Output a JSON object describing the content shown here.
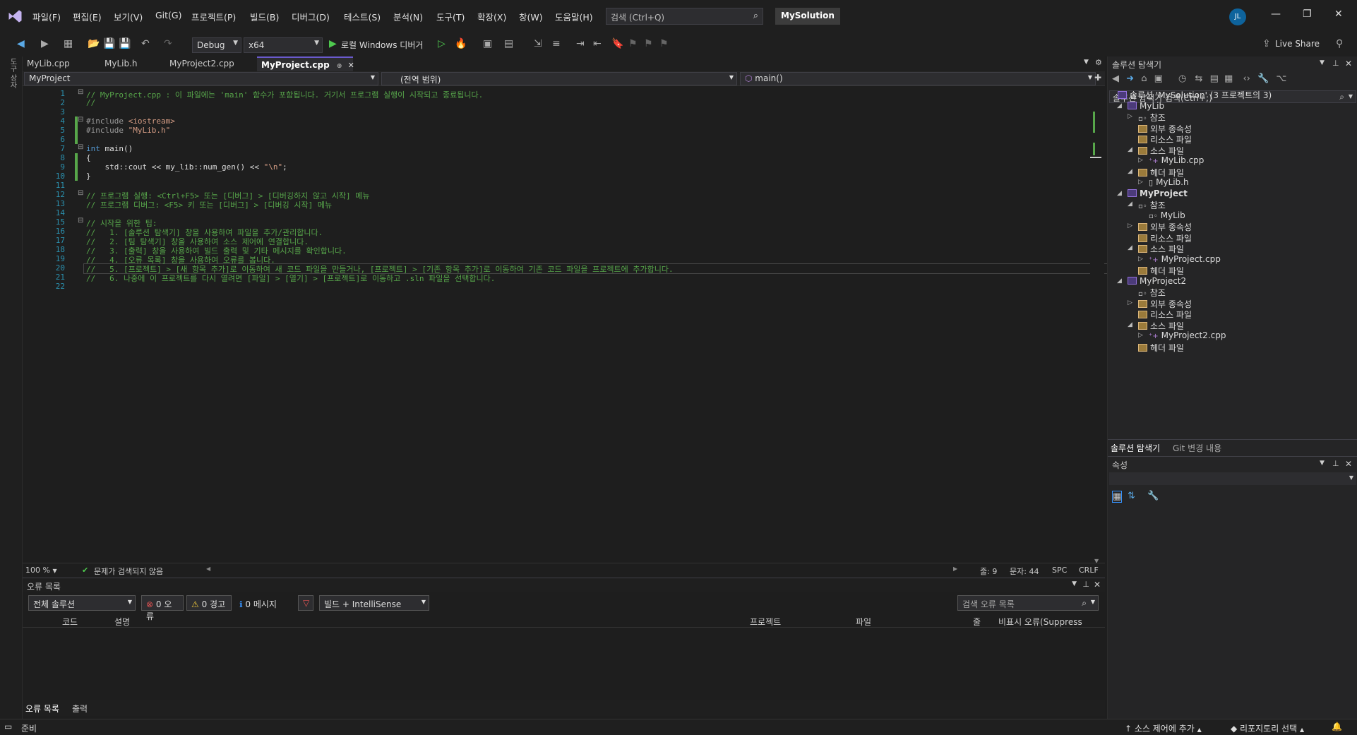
{
  "menubar": {
    "items": [
      "파일(F)",
      "편집(E)",
      "보기(V)",
      "Git(G)",
      "프로젝트(P)",
      "빌드(B)",
      "디버그(D)",
      "테스트(S)",
      "분석(N)",
      "도구(T)",
      "확장(X)",
      "창(W)",
      "도움말(H)"
    ],
    "search_placeholder": "검색 (Ctrl+Q)",
    "solution_name": "MySolution",
    "avatar_initials": "JL"
  },
  "toolbar": {
    "config": "Debug",
    "platform": "x64",
    "run_label": "로컬 Windows 디버거",
    "live_share": "Live Share"
  },
  "tabs": [
    "MyLib.cpp",
    "MyLib.h",
    "MyProject2.cpp",
    "MyProject.cpp"
  ],
  "navbar": {
    "project": "MyProject",
    "scope": "(전역 범위)",
    "member": "main()"
  },
  "code": {
    "lines": [
      {
        "n": "1",
        "segs": [
          {
            "c": "cmt",
            "t": "// MyProject.cpp : 이 파일에는 'main' 함수가 포함됩니다. 거기서 프로그램 실행이 시작되고 종료됩니다."
          }
        ]
      },
      {
        "n": "2",
        "segs": [
          {
            "c": "cmt",
            "t": "//"
          }
        ]
      },
      {
        "n": "3",
        "segs": []
      },
      {
        "n": "4",
        "segs": [
          {
            "c": "pp",
            "t": "#include "
          },
          {
            "c": "str",
            "t": "<iostream>"
          }
        ]
      },
      {
        "n": "5",
        "segs": [
          {
            "c": "pp",
            "t": "#include "
          },
          {
            "c": "str",
            "t": "\"MyLib.h\""
          }
        ]
      },
      {
        "n": "6",
        "segs": []
      },
      {
        "n": "7",
        "segs": [
          {
            "c": "kw",
            "t": "int"
          },
          {
            "c": "txt",
            "t": " main()"
          }
        ]
      },
      {
        "n": "8",
        "segs": [
          {
            "c": "txt",
            "t": "{"
          }
        ]
      },
      {
        "n": "9",
        "segs": [
          {
            "c": "txt",
            "t": "    std::cout << my_lib::num_gen() << "
          },
          {
            "c": "str",
            "t": "\"\\n\""
          },
          {
            "c": "txt",
            "t": ";"
          }
        ]
      },
      {
        "n": "10",
        "segs": [
          {
            "c": "txt",
            "t": "}"
          }
        ]
      },
      {
        "n": "11",
        "segs": []
      },
      {
        "n": "12",
        "segs": [
          {
            "c": "cmt",
            "t": "// 프로그램 실행: <Ctrl+F5> 또는 [디버그] > [디버깅하지 않고 시작] 메뉴"
          }
        ]
      },
      {
        "n": "13",
        "segs": [
          {
            "c": "cmt",
            "t": "// 프로그램 디버그: <F5> 키 또는 [디버그] > [디버깅 시작] 메뉴"
          }
        ]
      },
      {
        "n": "14",
        "segs": []
      },
      {
        "n": "15",
        "segs": [
          {
            "c": "cmt",
            "t": "// 시작을 위한 팁:"
          }
        ]
      },
      {
        "n": "16",
        "segs": [
          {
            "c": "cmt",
            "t": "//   1. [솔루션 탐색기] 창을 사용하여 파일을 추가/관리합니다."
          }
        ]
      },
      {
        "n": "17",
        "segs": [
          {
            "c": "cmt",
            "t": "//   2. [팀 탐색기] 창을 사용하여 소스 제어에 연결합니다."
          }
        ]
      },
      {
        "n": "18",
        "segs": [
          {
            "c": "cmt",
            "t": "//   3. [출력] 창을 사용하여 빌드 출력 및 기타 메시지를 확인합니다."
          }
        ]
      },
      {
        "n": "19",
        "segs": [
          {
            "c": "cmt",
            "t": "//   4. [오류 목록] 창을 사용하여 오류를 봅니다."
          }
        ]
      },
      {
        "n": "20",
        "segs": [
          {
            "c": "cmt",
            "t": "//   5. [프로젝트] > [새 항목 추가]로 이동하여 새 코드 파일을 만들거나, [프로젝트] > [기존 항목 추가]로 이동하여 기존 코드 파일을 프로젝트에 추가합니다."
          }
        ]
      },
      {
        "n": "21",
        "segs": [
          {
            "c": "cmt",
            "t": "//   6. 나중에 이 프로젝트를 다시 열려면 [파일] > [열기] > [프로젝트]로 이동하고 .sln 파일을 선택합니다."
          }
        ]
      },
      {
        "n": "22",
        "segs": []
      }
    ]
  },
  "editor_status": {
    "zoom": "100 %",
    "issues": "문제가 검색되지 않음",
    "line": "줄: 9",
    "col": "문자: 44",
    "spc": "SPC",
    "eol": "CRLF"
  },
  "error_list": {
    "title": "오류 목록",
    "scope": "전체 솔루션",
    "errors": "0 오류",
    "warnings": "0 경고",
    "messages": "0 메시지",
    "source": "빌드 + IntelliSense",
    "search_placeholder": "검색 오류 목록",
    "columns": [
      "코드",
      "설명",
      "프로젝트",
      "파일",
      "줄",
      "비표시 오류(Suppress"
    ],
    "tabs": [
      "오류 목록",
      "출력"
    ]
  },
  "solution_explorer": {
    "title": "솔루션 탐색기",
    "search_placeholder": "솔루션 탐색기 검색(Ctrl+;)",
    "root": "솔루션 'MySolution' (3 프로젝트의 3)",
    "items": [
      "MyLib",
      "참조",
      "외부 종속성",
      "리소스 파일",
      "소스 파일",
      "MyLib.cpp",
      "헤더 파일",
      "MyLib.h",
      "MyProject",
      "참조",
      "MyLib",
      "외부 종속성",
      "리소스 파일",
      "소스 파일",
      "MyProject.cpp",
      "헤더 파일",
      "MyProject2",
      "참조",
      "외부 종속성",
      "리소스 파일",
      "소스 파일",
      "MyProject2.cpp",
      "헤더 파일"
    ],
    "bottom_tabs": [
      "솔루션 탐색기",
      "Git 변경 내용"
    ]
  },
  "properties": {
    "title": "속성"
  },
  "statusbar": {
    "ready": "준비",
    "source_control": "소스 제어에 추가",
    "repo": "리포지토리 선택"
  }
}
